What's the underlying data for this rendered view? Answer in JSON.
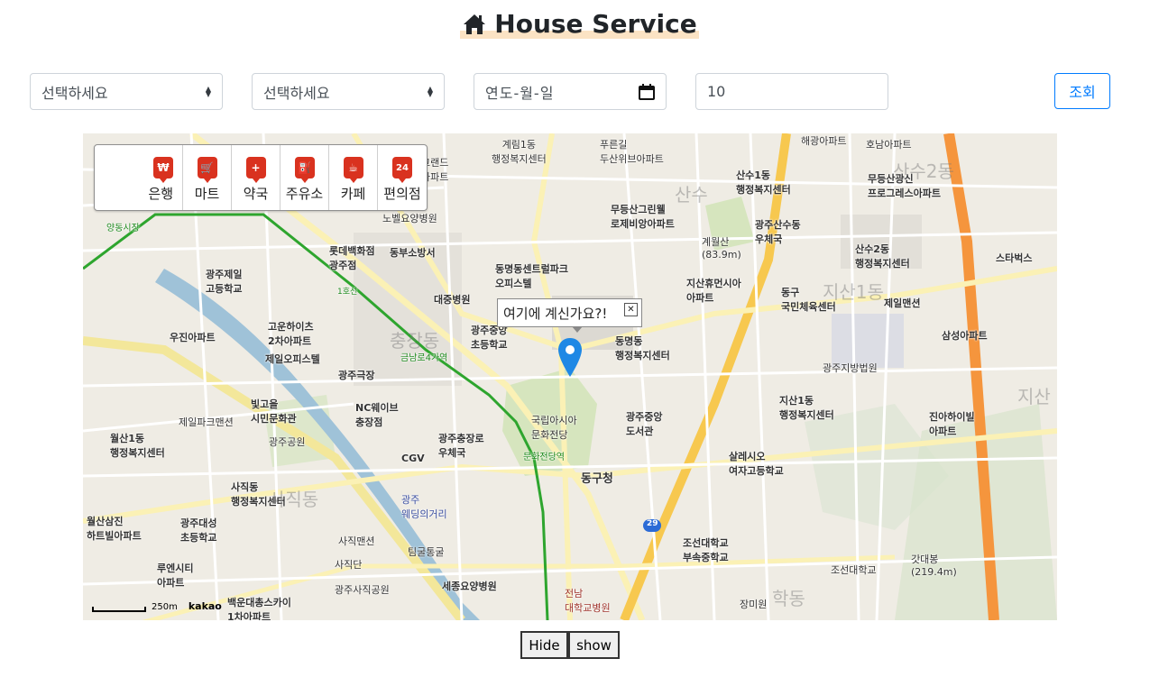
{
  "header": {
    "title": "House Service",
    "icon": "home-icon"
  },
  "controls": {
    "select1": "선택하세요",
    "select2": "선택하세요",
    "date_placeholder": "연도-월-일",
    "number_value": "10",
    "query_label": "조회"
  },
  "colors": {
    "accent": "#007bff",
    "marker": "#1e88e5",
    "highlight": "#fbe3c4",
    "category_icon": "#d9321f"
  },
  "map": {
    "categories": [
      {
        "label": "은행",
        "icon": "₩"
      },
      {
        "label": "마트",
        "icon": "🛒"
      },
      {
        "label": "약국",
        "icon": "+"
      },
      {
        "label": "주유소",
        "icon": "⛽"
      },
      {
        "label": "카페",
        "icon": "☕"
      },
      {
        "label": "편의점",
        "icon": "24"
      }
    ],
    "infowindow_text": "여기에 계신가요?!",
    "scale_text": "250m",
    "logo_text": "kakao",
    "labels": {
      "l1": "계림1동\n행정복지센터",
      "l2": "푸른길\n두산위브아파트",
      "l3": "해광아파트",
      "l4": "호남아파트",
      "l5": "그랜드\n아파트",
      "l6": "산수1동\n행정복지센터",
      "l7": "무등산광신\n프로그레스아파트",
      "l8": "무등산그린웰\n로제비앙아파트",
      "l9": "광주산수동\n우체국",
      "l10": "노벨요양병원",
      "l11": "롯데백화점\n광주점",
      "l12": "동부소방서",
      "l13": "계월산\n(83.9m)",
      "l14": "산수2동\n행정복지센터",
      "l15": "스타벅스",
      "l16": "광주제일\n고등학교",
      "l17": "동명동센트럴파크\n오피스텔",
      "l18": "지산휴먼시아\n아파트",
      "l19": "동구\n국민체육센터",
      "l20": "제일맨션",
      "l21": "대중병원",
      "l22": "고운하이츠\n2차아파트",
      "l23": "광주중앙\n초등학교",
      "l24": "동명동\n행정복지센터",
      "l25": "삼성아파트",
      "l26": "우진아파트",
      "l27": "제일오피스텔",
      "l28": "광주극장",
      "l29": "광주지방법원",
      "l30": "빛고을\n시민문화관",
      "l31": "NC웨이브\n충장점",
      "l32": "광주중앙\n도서관",
      "l33": "지산1동\n행정복지센터",
      "l34": "진아하이빌\n아파트",
      "l35": "월산1동\n행정복지센터",
      "l36": "제일파크맨션",
      "l37": "광주공원",
      "l38": "광주충장로\n우체국",
      "l39": "국립아시아\n문화전당",
      "l40": "CGV",
      "l41": "살레시오\n여자고등학교",
      "l42": "사직동\n행정복지센터",
      "l43": "동구청",
      "l44": "광주\n웨딩의거리",
      "l45": "월산삼진\n하트빌아파트",
      "l46": "광주대성\n초등학교",
      "l47": "사직맨션",
      "l48": "조선대학교\n부속중학교",
      "l49": "갓대봉\n(219.4m)",
      "l50": "팀굴통굴",
      "l51": "조선대학교",
      "l52": "루엔시티\n아파트",
      "l53": "사직단",
      "l54": "세종요양병원",
      "l55": "광주사직공원",
      "l56": "전남\n대학교병원",
      "l57": "장미원",
      "l58": "백운대총스카이\n1차아파트",
      "l59": "충장동",
      "l60": "산수",
      "l61": "산수2동",
      "l62": "지산1동",
      "l63": "지산",
      "l64": "학동",
      "l65": "사직동",
      "l66": "문화전당역",
      "l67": "금남로4가역",
      "l68": "1호선",
      "l69": "29",
      "l70": "양동시장"
    }
  },
  "footer": {
    "hide_label": "Hide",
    "show_label": "show"
  }
}
